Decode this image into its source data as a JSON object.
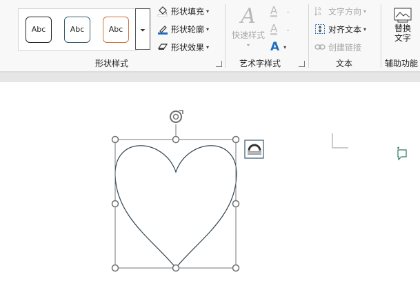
{
  "ribbon": {
    "shape_styles": {
      "gallery": [
        {
          "label": "Abc",
          "border": "#222222"
        },
        {
          "label": "Abc",
          "border": "#3a5a6e"
        },
        {
          "label": "Abc",
          "border": "#d0703a"
        }
      ],
      "fill_label": "形状填充",
      "outline_label": "形状轮廓",
      "effects_label": "形状效果",
      "group_label": "形状样式"
    },
    "wordart": {
      "quick_styles_label": "快速样式",
      "group_label": "艺术字样式"
    },
    "text": {
      "direction_label": "文字方向",
      "align_label": "对齐文本",
      "link_label": "创建链接",
      "group_label": "文本"
    },
    "accessibility": {
      "alt_text_label_line1": "替换",
      "alt_text_label_line2": "文字",
      "group_label": "辅助功能"
    }
  },
  "colors": {
    "accent_blue": "#1f6fc1",
    "handle_gray": "#6e6e6e",
    "heart_stroke": "#2e4350"
  }
}
